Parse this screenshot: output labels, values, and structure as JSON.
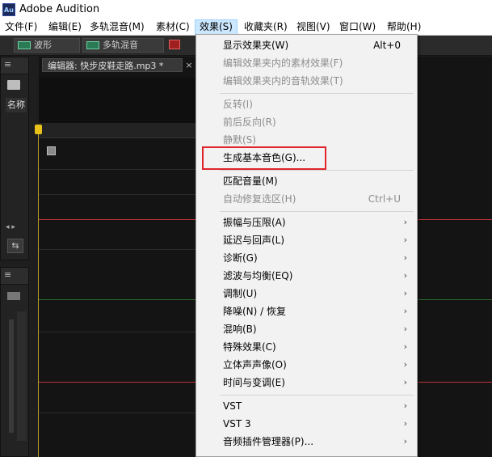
{
  "app": {
    "title": "Adobe Audition",
    "icon_text": "Au"
  },
  "menubar": {
    "items": [
      {
        "label": "文件(F)"
      },
      {
        "label": "编辑(E)"
      },
      {
        "label": "多轨混音(M)"
      },
      {
        "label": "素材(C)"
      },
      {
        "label": "效果(S)"
      },
      {
        "label": "收藏夹(R)"
      },
      {
        "label": "视图(V)"
      },
      {
        "label": "窗口(W)"
      },
      {
        "label": "帮助(H)"
      }
    ]
  },
  "toolbar": {
    "waveform_label": "波形",
    "multitrack_label": "多轨混音"
  },
  "files_panel": {
    "column_name": "名称"
  },
  "editor": {
    "tab_label": "编辑器: 快步皮鞋走路.mp3 *",
    "close_glyph": "×"
  },
  "effects_menu": {
    "items": [
      {
        "label": "显示效果夹(W)",
        "shortcut": "Alt+0",
        "disabled": false
      },
      {
        "label": "编辑效果夹内的素材效果(F)",
        "disabled": true
      },
      {
        "label": "编辑效果夹内的音轨效果(T)",
        "disabled": true
      },
      {
        "label": "反转(I)",
        "disabled": true
      },
      {
        "label": "前后反向(R)",
        "disabled": true
      },
      {
        "label": "静默(S)",
        "disabled": true
      },
      {
        "label": "生成基本音色(G)...",
        "disabled": false
      },
      {
        "label": "匹配音量(M)",
        "disabled": false
      },
      {
        "label": "自动修复选区(H)",
        "shortcut": "Ctrl+U",
        "disabled": true
      },
      {
        "label": "振幅与压限(A)",
        "submenu": true
      },
      {
        "label": "延迟与回声(L)",
        "submenu": true
      },
      {
        "label": "诊断(G)",
        "submenu": true
      },
      {
        "label": "滤波与均衡(EQ)",
        "submenu": true
      },
      {
        "label": "调制(U)",
        "submenu": true
      },
      {
        "label": "降噪(N) / 恢复",
        "submenu": true
      },
      {
        "label": "混响(B)",
        "submenu": true
      },
      {
        "label": "特殊效果(C)",
        "submenu": true
      },
      {
        "label": "立体声声像(O)",
        "submenu": true
      },
      {
        "label": "时间与变调(E)",
        "submenu": true
      },
      {
        "label": "VST",
        "submenu": true
      },
      {
        "label": "VST 3",
        "submenu": true
      },
      {
        "label": "音频插件管理器(P)...",
        "submenu": true
      }
    ],
    "submenu_arrow": "›"
  },
  "colors": {
    "highlight_border": "#e0242a",
    "waveform_red": "#c0353a",
    "waveform_green": "#2f6a2f"
  }
}
